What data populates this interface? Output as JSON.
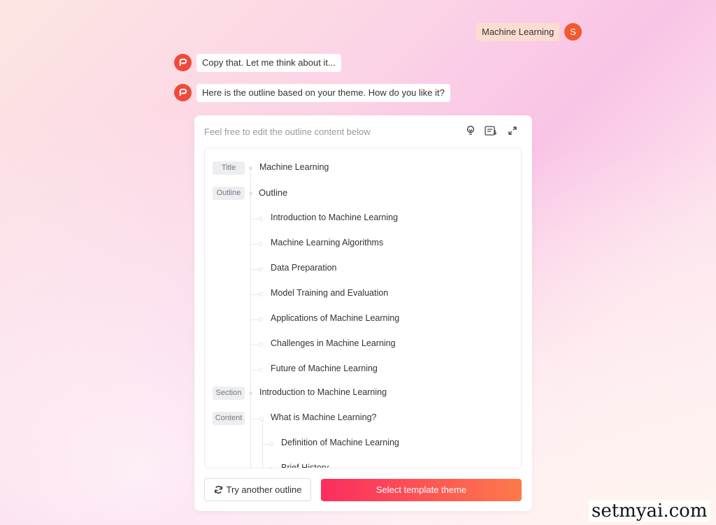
{
  "user_message": "Machine Learning",
  "user_avatar": "S",
  "bot_messages": [
    "Copy that. Let me think about it...",
    "Here is the outline based on your theme. How do you like it?"
  ],
  "card": {
    "hint": "Feel free to edit the outline content below",
    "tools": [
      "lightbulb-icon",
      "insert-list-icon",
      "expand-icon"
    ],
    "tags": {
      "title": "Title",
      "outline": "Outline",
      "section": "Section",
      "content": "Content"
    },
    "title": "Machine Learning",
    "outline_heading": "Outline",
    "outline_items": [
      "Introduction to Machine Learning",
      "Machine Learning Algorithms",
      "Data Preparation",
      "Model Training and Evaluation",
      "Applications of Machine Learning",
      "Challenges in Machine Learning",
      "Future of Machine Learning"
    ],
    "section": "Introduction to Machine Learning",
    "content_heading": "What is Machine Learning?",
    "content_items": [
      "Definition of Machine Learning",
      "Brief History"
    ],
    "try_label": "Try another outline",
    "select_label": "Select template theme"
  },
  "colors": {
    "accent": "#fb2d5f",
    "accent_end": "#fd7a4a",
    "avatar": "#f05a2c"
  },
  "watermark": "setmyai.com"
}
